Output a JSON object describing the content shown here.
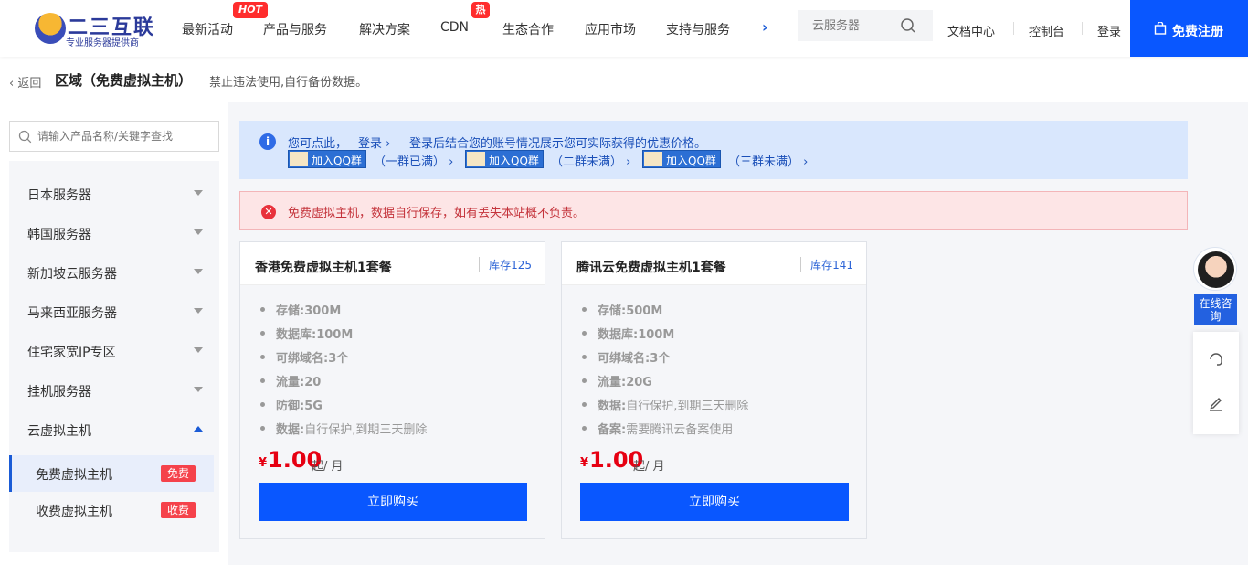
{
  "header": {
    "logo_title": "二三互联",
    "logo_sub": "专业服务器提供商",
    "nav": [
      "最新活动",
      "产品与服务",
      "解决方案",
      "CDN",
      "生态合作",
      "应用市场",
      "支持与服务"
    ],
    "badge_hot": "HOT",
    "badge_re": "热",
    "more": "›",
    "search_placeholder": "云服务器",
    "links": [
      "文档中心",
      "控制台",
      "登录"
    ],
    "register": "免费注册"
  },
  "breadcrumb": {
    "back": "返回",
    "title": "区域（免费虚拟主机）",
    "note": "禁止违法使用,自行备份数据。"
  },
  "sidebar": {
    "search_placeholder": "请输入产品名称/关键字查找",
    "items": [
      "日本服务器",
      "韩国服务器",
      "新加坡云服务器",
      "马来西亚服务器",
      "住宅家宽IP专区",
      "挂机服务器",
      "云虚拟主机"
    ],
    "sub_items": [
      {
        "label": "免费虚拟主机",
        "tag": "免费"
      },
      {
        "label": "收费虚拟主机",
        "tag": "收费"
      }
    ]
  },
  "info": {
    "line1": "您可点此，",
    "login": "登录 ›",
    "rest": "登录后结合您的账号情况展示您可实际获得的优惠价格。",
    "qq_label": "加入QQ群",
    "qq_groups": [
      "（一群已满） ›",
      "（二群未满） ›",
      "（三群未满） ›"
    ]
  },
  "warning": {
    "text": "免费虚拟主机，数据自行保存，如有丢失本站概不负责。"
  },
  "cards": [
    {
      "title": "香港免费虚拟主机1套餐",
      "stock": "库存125",
      "specs": [
        {
          "k": "存储:",
          "v": "300M"
        },
        {
          "k": "数据库:",
          "v": "100M"
        },
        {
          "k": "可绑域名:",
          "v": "3个"
        },
        {
          "k": "流量:",
          "v": "20"
        },
        {
          "k": "防御:",
          "v": "5G"
        },
        {
          "k": "数据:",
          "v": "自行保护,到期三天删除"
        }
      ],
      "currency": "¥",
      "price": "1.00",
      "unit": "起/ 月",
      "button": "立即购买"
    },
    {
      "title": "腾讯云免费虚拟主机1套餐",
      "stock": "库存141",
      "specs": [
        {
          "k": "存储:",
          "v": "500M"
        },
        {
          "k": "数据库:",
          "v": "100M"
        },
        {
          "k": "可绑域名:",
          "v": "3个"
        },
        {
          "k": "流量:",
          "v": "20G"
        },
        {
          "k": "数据:",
          "v": "自行保护,到期三天删除"
        },
        {
          "k": "备案:",
          "v": "需要腾讯云备案使用"
        }
      ],
      "currency": "¥",
      "price": "1.00",
      "unit": "起/ 月",
      "button": "立即购买"
    }
  ],
  "float": {
    "online": "在线咨询"
  },
  "colors": {
    "primary": "#0957ff",
    "danger": "#e8323c",
    "info_bg": "#d9e7fd"
  }
}
